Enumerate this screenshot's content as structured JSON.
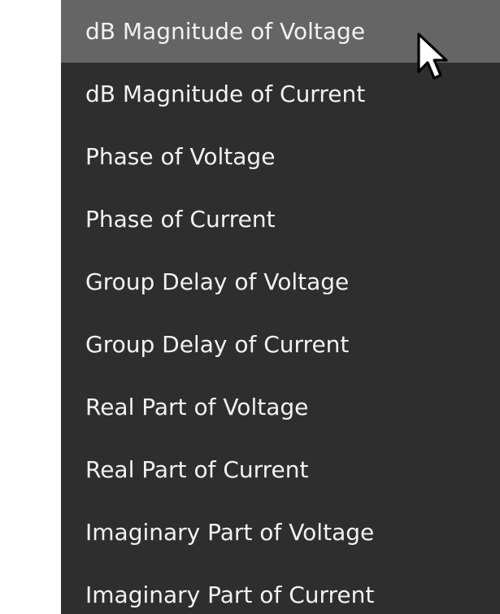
{
  "menu": {
    "hovered_index": 0,
    "items": [
      {
        "label": "dB Magnitude of Voltage"
      },
      {
        "label": "dB Magnitude of Current"
      },
      {
        "label": "Phase of Voltage"
      },
      {
        "label": "Phase of Current"
      },
      {
        "label": "Group Delay of Voltage"
      },
      {
        "label": "Group Delay of Current"
      },
      {
        "label": "Real Part of Voltage"
      },
      {
        "label": "Real Part of Current"
      },
      {
        "label": "Imaginary Part of Voltage"
      },
      {
        "label": "Imaginary Part of Current"
      }
    ]
  },
  "colors": {
    "menu_background": "#2e2e2e",
    "hover_background": "#656565",
    "text": "#f2f2f2"
  },
  "icons": {
    "cursor": "mouse-pointer-icon"
  }
}
